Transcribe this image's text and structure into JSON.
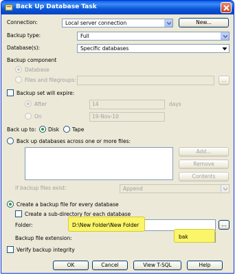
{
  "title": "Back Up Database Task",
  "connection": {
    "label": "Connection:",
    "value": "Local server connection",
    "new_button": "New..."
  },
  "backup_type": {
    "label": "Backup type:",
    "value": "Full"
  },
  "databases": {
    "label": "Database(s):",
    "value": "Specific databases"
  },
  "backup_component": {
    "label": "Backup component",
    "database_option": "Database",
    "files_option": "Files and filegroups:",
    "files_browse": "..."
  },
  "expire": {
    "checkbox_label": "Backup set will expire:",
    "after_label": "After",
    "after_value": "14",
    "days_label": "days",
    "on_label": "On",
    "on_value": "19-Nov-10"
  },
  "backup_to": {
    "label": "Back up to:",
    "disk": "Disk",
    "tape": "Tape"
  },
  "across_files": {
    "label": "Back up databases across one or more files:",
    "add": "Add...",
    "remove": "Remove",
    "contents": "Contents"
  },
  "if_exists": {
    "label": "If backup files exist:",
    "value": "Append"
  },
  "per_database": {
    "label": "Create a backup file for every database",
    "subdir_label": "Create a sub-directory for each database",
    "folder_label": "Folder:",
    "folder_value": "D:\\New Folder\\New Folder",
    "folder_browse": "...",
    "extension_label": "Backup file extension:",
    "extension_value": "bak"
  },
  "verify": {
    "label": "Verify backup integrity"
  },
  "buttons": {
    "ok": "OK",
    "cancel": "Cancel",
    "view_tsql": "View T-SQL",
    "help": "Help"
  }
}
